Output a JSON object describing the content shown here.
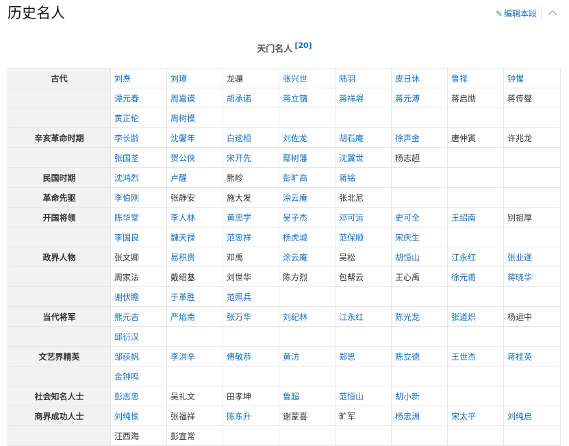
{
  "header": {
    "title": "历史名人",
    "edit_label": "编辑本段"
  },
  "table": {
    "caption": "天门名人",
    "caption_ref": "[20]",
    "rows": [
      {
        "category": "古代",
        "cells": [
          {
            "text": "刘焘",
            "link": true
          },
          {
            "text": "刘璋",
            "link": true
          },
          {
            "text": "龙骧",
            "link": false
          },
          {
            "text": "张兴世",
            "link": true
          },
          {
            "text": "陆羽",
            "link": true
          },
          {
            "text": "皮日休",
            "link": true
          },
          {
            "text": "鲁择",
            "link": true
          },
          {
            "text": "钟惺",
            "link": true
          }
        ]
      },
      {
        "category": "",
        "cells": [
          {
            "text": "谭元春",
            "link": true
          },
          {
            "text": "周嘉谟",
            "link": true
          },
          {
            "text": "胡承诺",
            "link": true
          },
          {
            "text": "蒋立镛",
            "link": true
          },
          {
            "text": "蒋祥墀",
            "link": true
          },
          {
            "text": "蒋元溥",
            "link": true
          },
          {
            "text": "蒋启勋",
            "link": false
          },
          {
            "text": "蒋传燮",
            "link": false
          }
        ]
      },
      {
        "category": "",
        "cells": [
          {
            "text": "黄正伦",
            "link": true
          },
          {
            "text": "周树模",
            "link": true
          },
          {
            "text": "",
            "link": false
          },
          {
            "text": "",
            "link": false
          },
          {
            "text": "",
            "link": false
          },
          {
            "text": "",
            "link": false
          },
          {
            "text": "",
            "link": false
          },
          {
            "text": "",
            "link": false
          }
        ]
      },
      {
        "category": "辛亥革命时期",
        "cells": [
          {
            "text": "李长龄",
            "link": true
          },
          {
            "text": "沈馨年",
            "link": true
          },
          {
            "text": "白逾桓",
            "link": true
          },
          {
            "text": "刘佐龙",
            "link": true
          },
          {
            "text": "胡石庵",
            "link": true
          },
          {
            "text": "徐声金",
            "link": true
          },
          {
            "text": "唐仲寅",
            "link": false
          },
          {
            "text": "许兆龙",
            "link": false
          }
        ]
      },
      {
        "category": "",
        "cells": [
          {
            "text": "张国荃",
            "link": true
          },
          {
            "text": "贺公侠",
            "link": true
          },
          {
            "text": "宋开先",
            "link": true
          },
          {
            "text": "鄢树藩",
            "link": true
          },
          {
            "text": "沈翼世",
            "link": true
          },
          {
            "text": "杨志超",
            "link": false
          },
          {
            "text": "",
            "link": false
          },
          {
            "text": "",
            "link": false
          }
        ]
      },
      {
        "category": "民国时期",
        "cells": [
          {
            "text": "沈鸿烈",
            "link": true
          },
          {
            "text": "卢醒",
            "link": true
          },
          {
            "text": "熊畛",
            "link": false
          },
          {
            "text": "彭旷高",
            "link": true
          },
          {
            "text": "蒋铭",
            "link": true
          },
          {
            "text": "",
            "link": false
          },
          {
            "text": "",
            "link": false
          },
          {
            "text": "",
            "link": false
          }
        ]
      },
      {
        "category": "革命先驱",
        "cells": [
          {
            "text": "李伯刚",
            "link": true
          },
          {
            "text": "张静安",
            "link": false
          },
          {
            "text": "施大发",
            "link": false
          },
          {
            "text": "涂云庵",
            "link": true
          },
          {
            "text": "张北尼",
            "link": false
          },
          {
            "text": "",
            "link": false
          },
          {
            "text": "",
            "link": false
          },
          {
            "text": "",
            "link": false
          }
        ]
      },
      {
        "category": "开国将领",
        "cells": [
          {
            "text": "陈华堂",
            "link": true
          },
          {
            "text": "李人林",
            "link": true
          },
          {
            "text": "黄忠学",
            "link": true
          },
          {
            "text": "吴子杰",
            "link": true
          },
          {
            "text": "邓可运",
            "link": true
          },
          {
            "text": "史可全",
            "link": true
          },
          {
            "text": "王绍南",
            "link": true
          },
          {
            "text": "别祖厚",
            "link": false
          }
        ]
      },
      {
        "category": "",
        "cells": [
          {
            "text": "李国良",
            "link": true
          },
          {
            "text": "魏天禄",
            "link": true
          },
          {
            "text": "范忠祥",
            "link": true
          },
          {
            "text": "杨虎城",
            "link": true
          },
          {
            "text": "范保顺",
            "link": true
          },
          {
            "text": "宋庆生",
            "link": true
          },
          {
            "text": "",
            "link": false
          },
          {
            "text": "",
            "link": false
          }
        ]
      },
      {
        "category": "政界人物",
        "cells": [
          {
            "text": "张文卿",
            "link": false
          },
          {
            "text": "易积贵",
            "link": true
          },
          {
            "text": "邓禹",
            "link": false
          },
          {
            "text": "涂云庵",
            "link": true
          },
          {
            "text": "吴松",
            "link": false
          },
          {
            "text": "胡恒山",
            "link": true
          },
          {
            "text": "江永红",
            "link": true
          },
          {
            "text": "张业遂",
            "link": true
          }
        ]
      },
      {
        "category": "",
        "cells": [
          {
            "text": "周家法",
            "link": false
          },
          {
            "text": "戴绍基",
            "link": false
          },
          {
            "text": "刘世华",
            "link": false
          },
          {
            "text": "陈方烈",
            "link": false
          },
          {
            "text": "包帮云",
            "link": false
          },
          {
            "text": "王心禹",
            "link": false
          },
          {
            "text": "徐元甫",
            "link": true
          },
          {
            "text": "蒋晓华",
            "link": true
          }
        ]
      },
      {
        "category": "",
        "cells": [
          {
            "text": "谢伏瞻",
            "link": true
          },
          {
            "text": "于革胜",
            "link": true
          },
          {
            "text": "范照兵",
            "link": true
          },
          {
            "text": "",
            "link": false
          },
          {
            "text": "",
            "link": false
          },
          {
            "text": "",
            "link": false
          },
          {
            "text": "",
            "link": false
          },
          {
            "text": "",
            "link": false
          }
        ]
      },
      {
        "category": "当代将军",
        "cells": [
          {
            "text": "熊元吉",
            "link": true
          },
          {
            "text": "严焰南",
            "link": true
          },
          {
            "text": "张万华",
            "link": true
          },
          {
            "text": "刘纪林",
            "link": true
          },
          {
            "text": "江永红",
            "link": true
          },
          {
            "text": "陈光龙",
            "link": true
          },
          {
            "text": "张道炽",
            "link": true
          },
          {
            "text": "杨运中",
            "link": false
          }
        ]
      },
      {
        "category": "",
        "cells": [
          {
            "text": "邱衍汉",
            "link": true
          },
          {
            "text": "",
            "link": false
          },
          {
            "text": "",
            "link": false
          },
          {
            "text": "",
            "link": false
          },
          {
            "text": "",
            "link": false
          },
          {
            "text": "",
            "link": false
          },
          {
            "text": "",
            "link": false
          },
          {
            "text": "",
            "link": false
          }
        ]
      },
      {
        "category": "文艺界精英",
        "cells": [
          {
            "text": "邹荻帆",
            "link": true
          },
          {
            "text": "李洪辛",
            "link": true
          },
          {
            "text": "傅敬恭",
            "link": true
          },
          {
            "text": "黄汸",
            "link": true
          },
          {
            "text": "郑思",
            "link": true
          },
          {
            "text": "陈立德",
            "link": true
          },
          {
            "text": "王世杰",
            "link": true
          },
          {
            "text": "蒋桂英",
            "link": true
          }
        ]
      },
      {
        "category": "",
        "cells": [
          {
            "text": "金钟鸣",
            "link": true
          },
          {
            "text": "",
            "link": false
          },
          {
            "text": "",
            "link": false
          },
          {
            "text": "",
            "link": false
          },
          {
            "text": "",
            "link": false
          },
          {
            "text": "",
            "link": false
          },
          {
            "text": "",
            "link": false
          },
          {
            "text": "",
            "link": false
          }
        ]
      },
      {
        "category": "社会知名人士",
        "cells": [
          {
            "text": "彭志忠",
            "link": true
          },
          {
            "text": "吴礼文",
            "link": false
          },
          {
            "text": "田孝坤",
            "link": false
          },
          {
            "text": "鲁超",
            "link": true
          },
          {
            "text": "范恒山",
            "link": true
          },
          {
            "text": "胡小新",
            "link": true
          },
          {
            "text": "",
            "link": false
          },
          {
            "text": "",
            "link": false
          }
        ]
      },
      {
        "category": "商界成功人士",
        "cells": [
          {
            "text": "刘纯愉",
            "link": true
          },
          {
            "text": "张福祥",
            "link": false
          },
          {
            "text": "陈东升",
            "link": true
          },
          {
            "text": "谢蒙喜",
            "link": false
          },
          {
            "text": "旷军",
            "link": false
          },
          {
            "text": "杨忠洲",
            "link": true
          },
          {
            "text": "宋太平",
            "link": true
          },
          {
            "text": "刘纯启",
            "link": true
          }
        ]
      },
      {
        "category": "",
        "cells": [
          {
            "text": "汪西海",
            "link": false
          },
          {
            "text": "彭宣常",
            "link": false
          },
          {
            "text": "",
            "link": false
          },
          {
            "text": "",
            "link": false
          },
          {
            "text": "",
            "link": false
          },
          {
            "text": "",
            "link": false
          },
          {
            "text": "",
            "link": false
          },
          {
            "text": "",
            "link": false
          }
        ]
      }
    ]
  },
  "colors": {
    "link": "#136ec2",
    "category_bg": "#f2f2f2",
    "border": "#e6e6e6",
    "edit_icon": "#3ca63c"
  },
  "icons": {
    "edit": "pencil-icon",
    "collapse": "chevron-up-icon"
  }
}
